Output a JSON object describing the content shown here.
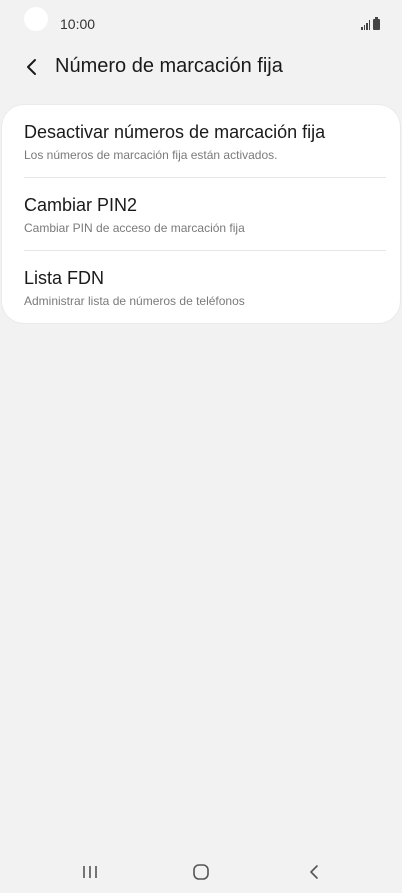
{
  "status_bar": {
    "time": "10:00",
    "icons": [
      "signal-icon",
      "battery-icon"
    ]
  },
  "app_bar": {
    "back_icon": "chevron-left-icon",
    "title": "Número de marcación fija"
  },
  "settings": {
    "items": [
      {
        "title": "Desactivar números de marcación fija",
        "subtitle": "Los números de marcación fija están activados."
      },
      {
        "title": "Cambiar PIN2",
        "subtitle": "Cambiar PIN de acceso de marcación fija"
      },
      {
        "title": "Lista FDN",
        "subtitle": "Administrar lista de números de teléfonos"
      }
    ]
  },
  "nav_bar": {
    "buttons": [
      "recent-apps-icon",
      "home-icon",
      "back-icon"
    ]
  },
  "colors": {
    "background": "#f2f2f2",
    "card": "#ffffff",
    "title_text": "#1a1a1a",
    "subtitle_text": "#7a7a7a",
    "divider": "#e6e6e6"
  }
}
